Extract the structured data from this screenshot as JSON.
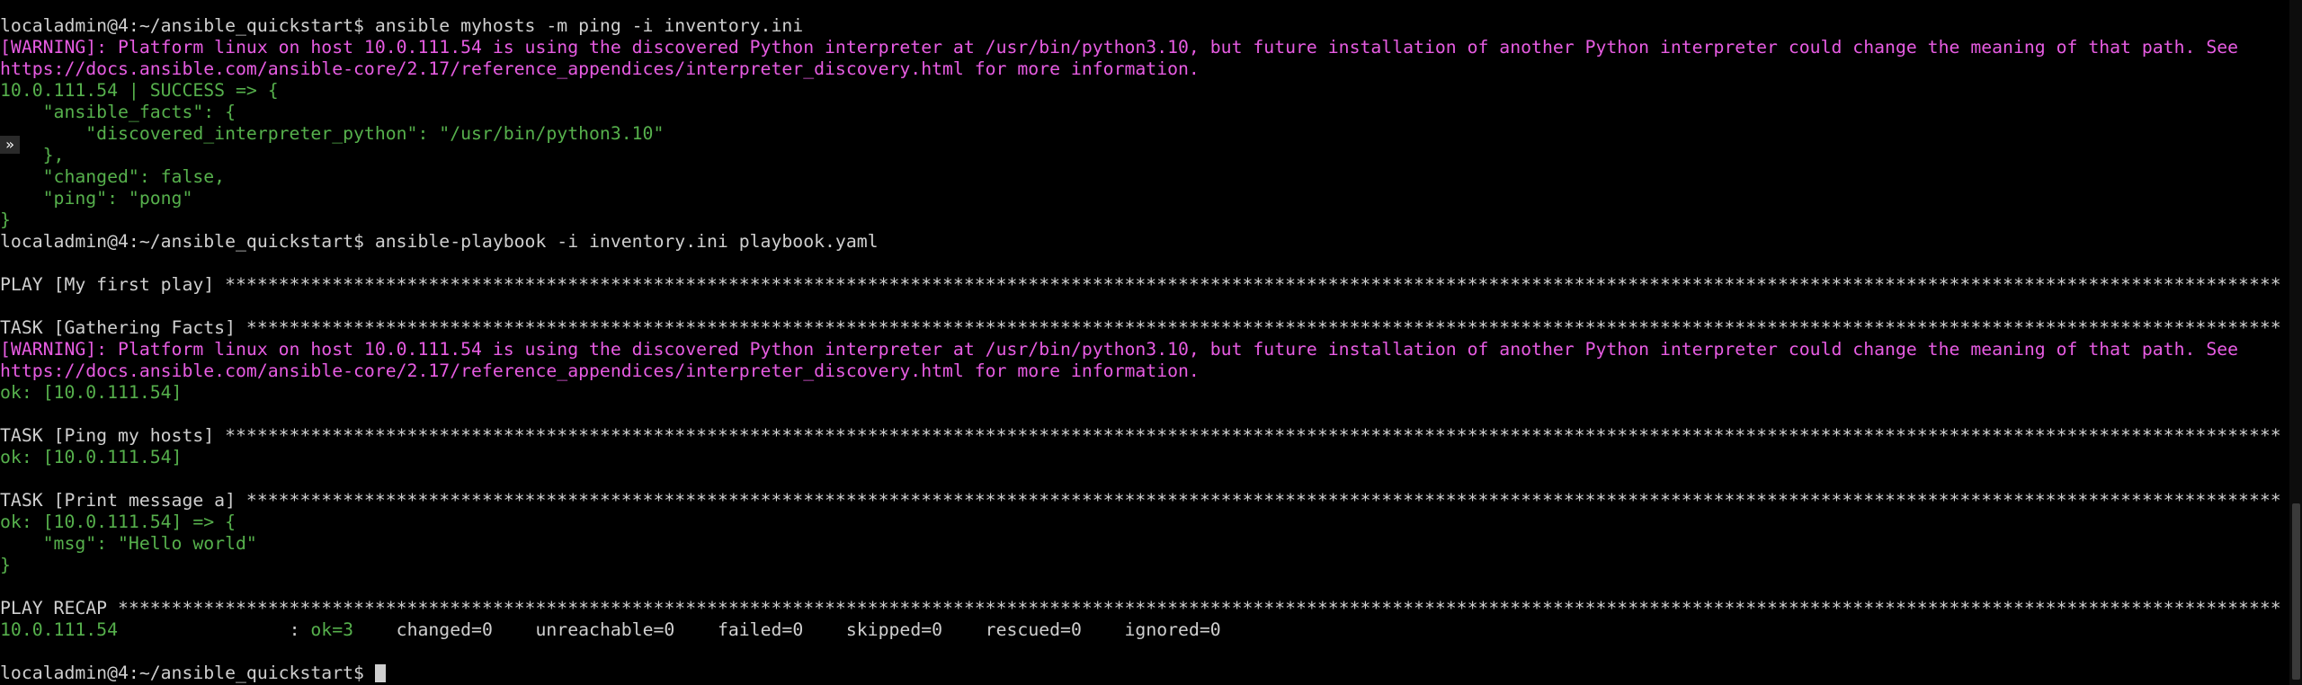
{
  "terminal": {
    "side_marker_glyph": "»",
    "lines": [
      [
        {
          "text": "localadmin@4:~/ansible_quickstart$ ansible myhosts -m ping -i inventory.ini",
          "cls": "p"
        }
      ],
      [
        {
          "text": "[WARNING]: Platform linux on host 10.0.111.54 is using the discovered Python interpreter at /usr/bin/python3.10, but future installation of another Python interpreter could change the meaning of that path. See",
          "cls": "w"
        }
      ],
      [
        {
          "text": "https://docs.ansible.com/ansible-core/2.17/reference_appendices/interpreter_discovery.html for more information.",
          "cls": "w"
        }
      ],
      [
        {
          "text": "10.0.111.54 | SUCCESS => {",
          "cls": "g"
        }
      ],
      [
        {
          "text": "    \"ansible_facts\": {",
          "cls": "g"
        }
      ],
      [
        {
          "text": "        \"discovered_interpreter_python\": \"/usr/bin/python3.10\"",
          "cls": "g"
        }
      ],
      [
        {
          "text": "    },",
          "cls": "g"
        }
      ],
      [
        {
          "text": "    \"changed\": false,",
          "cls": "g"
        }
      ],
      [
        {
          "text": "    \"ping\": \"pong\"",
          "cls": "g"
        }
      ],
      [
        {
          "text": "}",
          "cls": "g"
        }
      ],
      [
        {
          "text": "localadmin@4:~/ansible_quickstart$ ansible-playbook -i inventory.ini playbook.yaml",
          "cls": "p"
        }
      ],
      [
        {
          "text": "",
          "cls": "p"
        }
      ],
      [
        {
          "text": "PLAY [My first play] ****************************************************************************************************************************************************************************************************************************************",
          "cls": "p"
        }
      ],
      [
        {
          "text": "",
          "cls": "p"
        }
      ],
      [
        {
          "text": "TASK [Gathering Facts] **************************************************************************************************************************************************************************************************************************************",
          "cls": "p"
        }
      ],
      [
        {
          "text": "[WARNING]: Platform linux on host 10.0.111.54 is using the discovered Python interpreter at /usr/bin/python3.10, but future installation of another Python interpreter could change the meaning of that path. See",
          "cls": "w"
        }
      ],
      [
        {
          "text": "https://docs.ansible.com/ansible-core/2.17/reference_appendices/interpreter_discovery.html for more information.",
          "cls": "w"
        }
      ],
      [
        {
          "text": "ok: [10.0.111.54]",
          "cls": "g"
        }
      ],
      [
        {
          "text": "",
          "cls": "p"
        }
      ],
      [
        {
          "text": "TASK [Ping my hosts] ****************************************************************************************************************************************************************************************************************************************",
          "cls": "p"
        }
      ],
      [
        {
          "text": "ok: [10.0.111.54]",
          "cls": "g"
        }
      ],
      [
        {
          "text": "",
          "cls": "p"
        }
      ],
      [
        {
          "text": "TASK [Print message a] **************************************************************************************************************************************************************************************************************************************",
          "cls": "p"
        }
      ],
      [
        {
          "text": "ok: [10.0.111.54] => {",
          "cls": "g"
        }
      ],
      [
        {
          "text": "    \"msg\": \"Hello world\"",
          "cls": "g"
        }
      ],
      [
        {
          "text": "}",
          "cls": "g"
        }
      ],
      [
        {
          "text": "",
          "cls": "p"
        }
      ],
      [
        {
          "text": "PLAY RECAP **********************************************************************************************************************************************************************************************************************************************",
          "cls": "p"
        }
      ],
      [
        {
          "text": "10.0.111.54",
          "cls": "g"
        },
        {
          "text": "                : ",
          "cls": "p"
        },
        {
          "text": "ok=3",
          "cls": "g"
        },
        {
          "text": "    changed=0    unreachable=0    failed=0    skipped=0    rescued=0    ignored=0",
          "cls": "p"
        }
      ],
      [
        {
          "text": "",
          "cls": "p"
        }
      ],
      [
        {
          "text": "localadmin@4:~/ansible_quickstart$ ",
          "cls": "p"
        }
      ]
    ]
  }
}
